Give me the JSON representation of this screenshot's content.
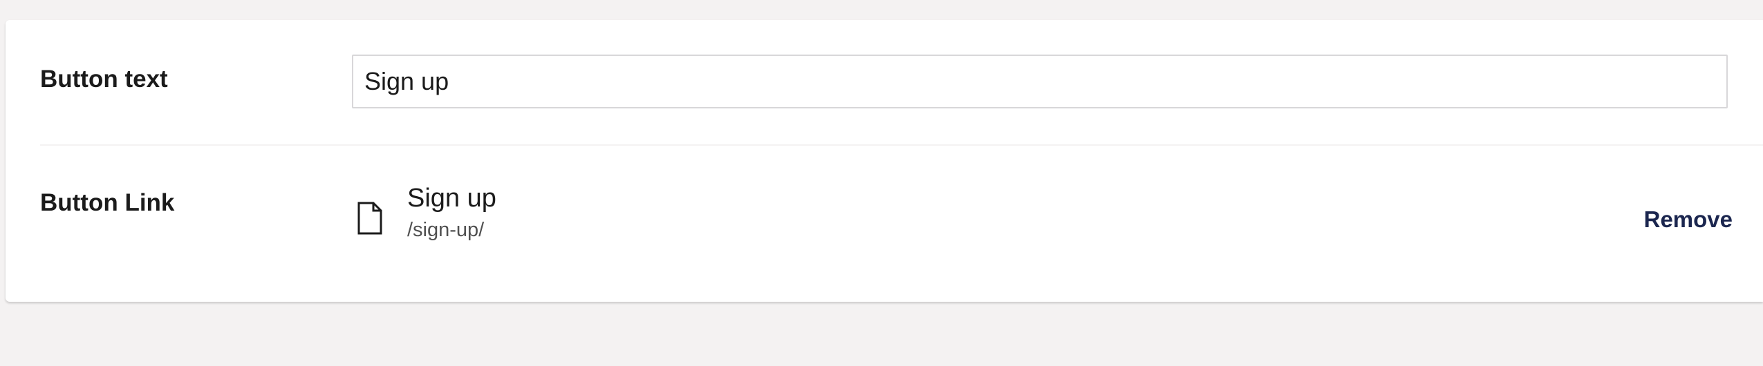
{
  "fields": {
    "button_text": {
      "label": "Button text",
      "value": "Sign up"
    },
    "button_link": {
      "label": "Button Link",
      "item": {
        "icon": "document-icon",
        "name": "Sign up",
        "url": "/sign-up/"
      },
      "remove_label": "Remove"
    }
  },
  "colors": {
    "page_background": "#f4f2f2",
    "panel_background": "#ffffff",
    "text": "#1b1b1b",
    "secondary_text": "#515151",
    "action_text": "#1b264f",
    "input_border": "#d8d7d9"
  }
}
